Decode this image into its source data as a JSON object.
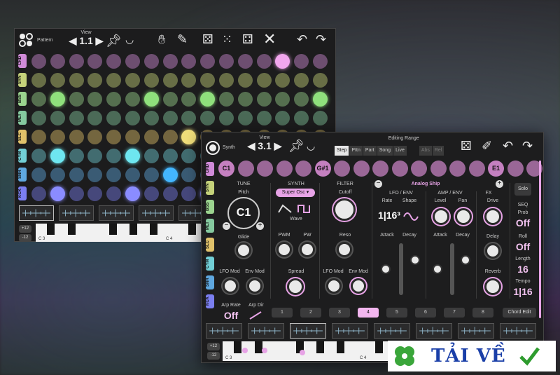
{
  "back": {
    "pattern_label": "Pattern",
    "view_label": "View",
    "view_value": "1.1",
    "lanes": [
      {
        "label": "CRD",
        "color": "#d08bd8"
      },
      {
        "label": "SYN",
        "color": "#c5d27a"
      },
      {
        "label": "BSS",
        "color": "#9bd48f"
      },
      {
        "label": "MLT",
        "color": "#85c99f"
      },
      {
        "label": "SLC",
        "color": "#e0c16a"
      },
      {
        "label": "CYM",
        "color": "#72cfd6"
      },
      {
        "label": "SNR",
        "color": "#5fa8e0"
      },
      {
        "label": "KCK",
        "color": "#7b7ff0"
      }
    ],
    "keyboard_labels": [
      "C 3",
      "C 4"
    ],
    "octave_up": "+12",
    "octave_down": "-12"
  },
  "front": {
    "instrument_label": "Synth",
    "view_label": "View",
    "view_value": "3.1",
    "editing_range_label": "Editing Range",
    "range_tabs": [
      "Step",
      "Pttn",
      "Part",
      "Song",
      "Live"
    ],
    "abs_tabs": [
      "Abs",
      "Rel"
    ],
    "chord_pads": [
      {
        "label": "C1"
      },
      {
        "label": ""
      },
      {
        "label": ""
      },
      {
        "label": ""
      },
      {
        "label": ""
      },
      {
        "label": "G#1"
      },
      {
        "label": ""
      },
      {
        "label": ""
      },
      {
        "label": ""
      },
      {
        "label": ""
      },
      {
        "label": ""
      },
      {
        "label": ""
      },
      {
        "label": ""
      },
      {
        "label": ""
      },
      {
        "label": "E1"
      },
      {
        "label": ""
      },
      {
        "label": ""
      }
    ],
    "preset_name": "Analog Ship",
    "sections": {
      "tune": "TUNE",
      "synth": "SYNTH",
      "filter": "FILTER",
      "lfo_env": "LFO / ENV",
      "amp_env": "AMP / ENV",
      "fx": "FX"
    },
    "tune": {
      "pitch_label": "Pitch",
      "pitch_value": "C1",
      "glide_label": "Glide",
      "lfo_mod": "LFO Mod",
      "env_mod": "Env Mod"
    },
    "synth": {
      "osc_label": "Super Osc",
      "wave_label": "Wave",
      "pwm": "PWM",
      "pw": "PW",
      "spread": "Spread"
    },
    "filter": {
      "cutoff": "Cutoff",
      "reso": "Reso",
      "lfo_mod": "LFO Mod",
      "env_mod": "Env Mod"
    },
    "lfo": {
      "rate": "Rate",
      "shape": "Shape",
      "rate_value": "1|16³",
      "attack": "Attack",
      "decay": "Decay"
    },
    "amp": {
      "level": "Level",
      "pan": "Pan",
      "attack": "Attack",
      "decay": "Decay"
    },
    "fx": {
      "drive": "Drive",
      "delay": "Delay",
      "reverb": "Reverb"
    },
    "seq": {
      "solo": "Solo",
      "seq_label": "SEQ",
      "prob_label": "Prob",
      "prob_value": "Off",
      "roll_label": "Roll",
      "roll_value": "Off",
      "length_label": "Length",
      "length_value": "16",
      "tempo_label": "Tempo",
      "tempo_value": "1|16"
    },
    "arp": {
      "rate_label": "Arp Rate",
      "rate_value": "Off",
      "dir_label": "Arp Dir"
    },
    "steps": [
      "1",
      "2",
      "3",
      "4",
      "5",
      "6",
      "7",
      "8"
    ],
    "active_step": "4",
    "chord_edit": "Chord Edit",
    "keyboard_labels": [
      "C 3",
      "C 4"
    ],
    "octave_up": "+12",
    "octave_down": "-12"
  },
  "watermark": {
    "text": "TẢI VỀ"
  },
  "colors": {
    "accent": "#e7a3e6",
    "pad_purple": "#c480c0"
  }
}
